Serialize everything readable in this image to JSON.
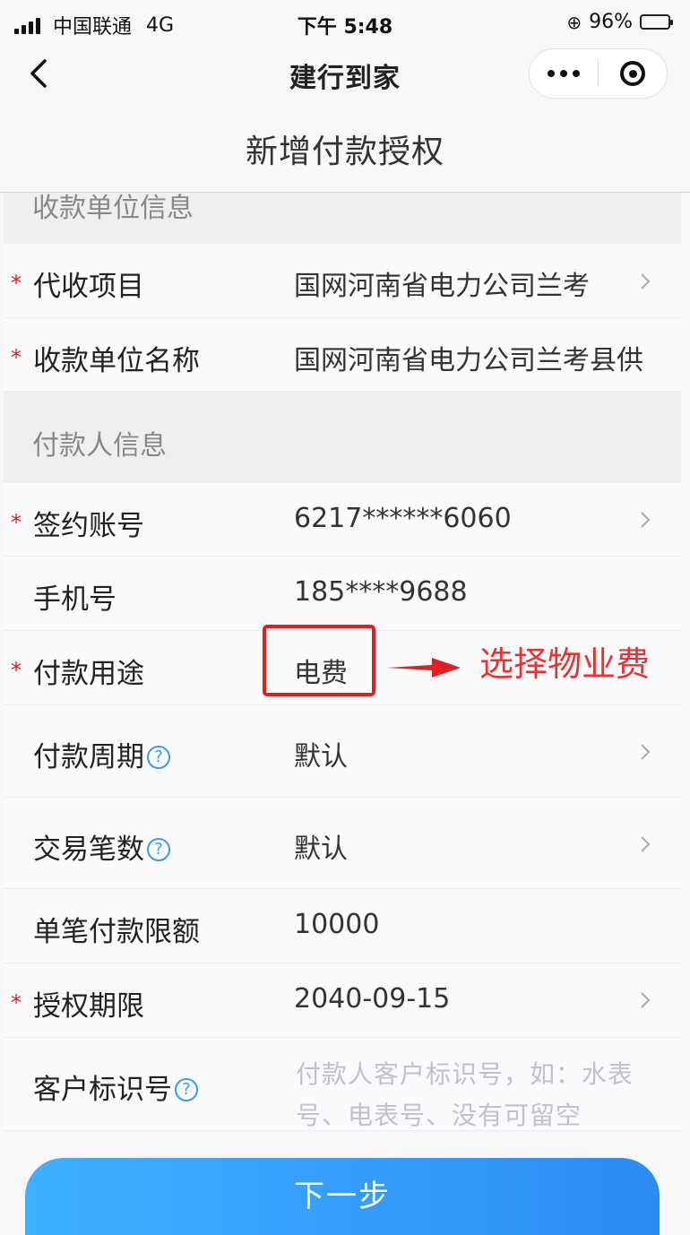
{
  "status_bar": {
    "carrier": "中国联通",
    "network": "4G",
    "time": "下午 5:48",
    "battery": "96%"
  },
  "nav": {
    "title": "建行到家",
    "back_icon": "chevron-left-icon",
    "more_icon": "more-dots-icon",
    "close_icon": "target-circle-icon"
  },
  "page": {
    "title": "新增付款授权"
  },
  "payee_section": {
    "title": "收款单位信息"
  },
  "payee_rows": [
    {
      "label": "代收项目",
      "value": "国网河南省电力公司兰考",
      "required": true,
      "has_arrow": true
    },
    {
      "label": "收款单位名称",
      "value": "国网河南省电力公司兰考县供",
      "required": true,
      "has_arrow": false
    }
  ],
  "payer_section": {
    "title": "付款人信息"
  },
  "payer_rows": [
    {
      "label": "签约账号",
      "value": "6217******6060",
      "required": true,
      "has_arrow": true
    },
    {
      "label": "手机号",
      "value": "185****9688",
      "required": false,
      "has_arrow": false
    },
    {
      "label": "付款用途",
      "value": "电费",
      "required": true,
      "has_arrow": false
    },
    {
      "label": "付款周期",
      "value": "默认",
      "required": false,
      "has_arrow": true,
      "help": "?"
    },
    {
      "label": "交易笔数",
      "value": "默认",
      "required": false,
      "has_arrow": true,
      "help": "?"
    },
    {
      "label": "单笔付款限额",
      "value": "10000",
      "required": false,
      "has_arrow": false
    },
    {
      "label": "授权期限",
      "value": "2040-09-15",
      "required": true,
      "has_arrow": true
    },
    {
      "label": "客户标识号",
      "placeholder": "付款人客户标识号，如：水表号、电表号、没有可留空",
      "required": false,
      "help": "?"
    }
  ],
  "required_mark": "*",
  "annotation": {
    "text": "选择物业费",
    "color": "#e02020"
  },
  "buttons": {
    "next": "下一步"
  },
  "colors": {
    "accent": "#2b8cf5",
    "required": "#e02020",
    "help": "#3a9ce0"
  }
}
